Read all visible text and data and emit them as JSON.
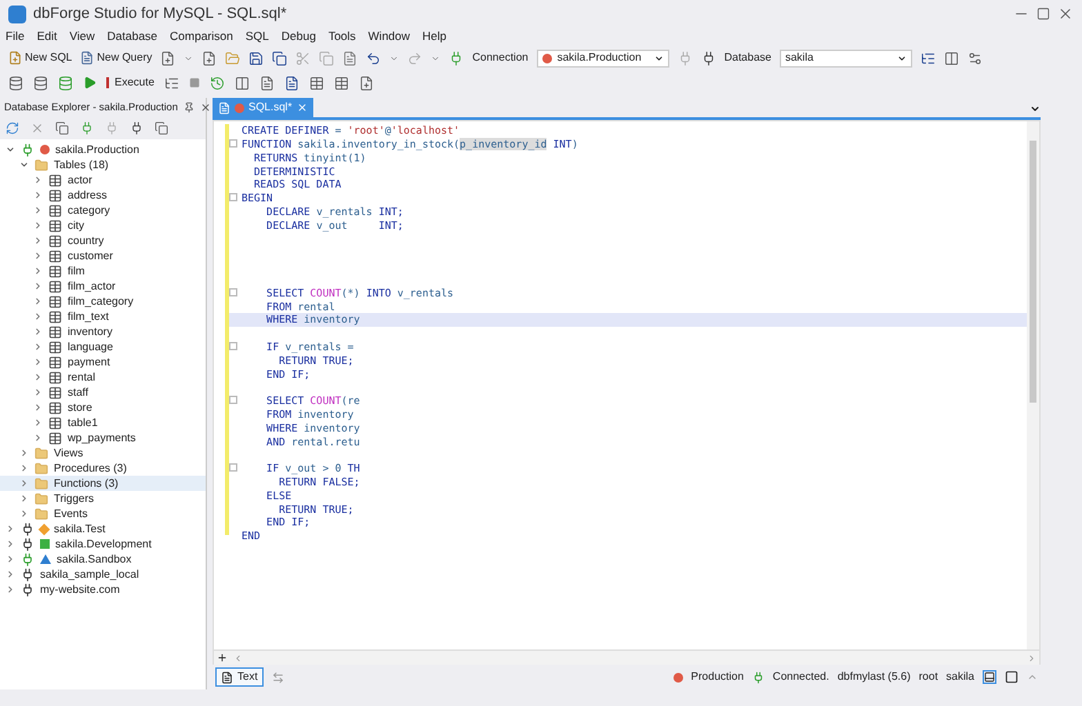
{
  "window": {
    "title": "dbForge Studio for MySQL - SQL.sql*"
  },
  "menu": [
    "File",
    "Edit",
    "View",
    "Database",
    "Comparison",
    "SQL",
    "Debug",
    "Tools",
    "Window",
    "Help"
  ],
  "toolbar": {
    "new_sql": "New SQL",
    "new_query": "New Query",
    "execute": "Execute",
    "connection_label": "Connection",
    "connection": {
      "value": "sakila.Production",
      "color": "#e05a47"
    },
    "database_label": "Database",
    "database": {
      "value": "sakila"
    }
  },
  "explorer": {
    "title": "Database Explorer - sakila.Production",
    "tree": [
      {
        "label": "sakila.Production",
        "kind": "connection",
        "marker": {
          "kind": "dot",
          "color": "#e05a47"
        },
        "connected": true,
        "expanded": true,
        "selected": false,
        "children": [
          {
            "label": "Tables (18)",
            "kind": "folder",
            "expanded": true,
            "selected": false,
            "children": [
              {
                "label": "actor",
                "kind": "table",
                "expanded": false,
                "selected": false
              },
              {
                "label": "address",
                "kind": "table",
                "expanded": false,
                "selected": false
              },
              {
                "label": "category",
                "kind": "table",
                "expanded": false,
                "selected": false
              },
              {
                "label": "city",
                "kind": "table",
                "expanded": false,
                "selected": false
              },
              {
                "label": "country",
                "kind": "table",
                "expanded": false,
                "selected": false
              },
              {
                "label": "customer",
                "kind": "table",
                "expanded": false,
                "selected": false
              },
              {
                "label": "film",
                "kind": "table",
                "expanded": false,
                "selected": false
              },
              {
                "label": "film_actor",
                "kind": "table",
                "expanded": false,
                "selected": false
              },
              {
                "label": "film_category",
                "kind": "table",
                "expanded": false,
                "selected": false
              },
              {
                "label": "film_text",
                "kind": "table",
                "expanded": false,
                "selected": false
              },
              {
                "label": "inventory",
                "kind": "table",
                "expanded": false,
                "selected": false
              },
              {
                "label": "language",
                "kind": "table",
                "expanded": false,
                "selected": false
              },
              {
                "label": "payment",
                "kind": "table",
                "expanded": false,
                "selected": false
              },
              {
                "label": "rental",
                "kind": "table",
                "expanded": false,
                "selected": false
              },
              {
                "label": "staff",
                "kind": "table",
                "expanded": false,
                "selected": false
              },
              {
                "label": "store",
                "kind": "table",
                "expanded": false,
                "selected": false
              },
              {
                "label": "table1",
                "kind": "table",
                "expanded": false,
                "selected": false
              },
              {
                "label": "wp_payments",
                "kind": "table",
                "expanded": false,
                "selected": false
              }
            ]
          },
          {
            "label": "Views",
            "kind": "folder",
            "expanded": false,
            "selected": false
          },
          {
            "label": "Procedures (3)",
            "kind": "folder",
            "expanded": false,
            "selected": false
          },
          {
            "label": "Functions (3)",
            "kind": "folder",
            "expanded": false,
            "selected": true
          },
          {
            "label": "Triggers",
            "kind": "folder",
            "expanded": false,
            "selected": false
          },
          {
            "label": "Events",
            "kind": "folder",
            "expanded": false,
            "selected": false
          }
        ]
      },
      {
        "label": "sakila.Test",
        "kind": "connection",
        "marker": {
          "kind": "diamond",
          "color": "#f0a030"
        },
        "connected": false,
        "expanded": false,
        "selected": false
      },
      {
        "label": "sakila.Development",
        "kind": "connection",
        "marker": {
          "kind": "square",
          "color": "#3cb043"
        },
        "connected": false,
        "expanded": false,
        "selected": false
      },
      {
        "label": "sakila.Sandbox",
        "kind": "connection",
        "marker": {
          "kind": "triangle",
          "color": "#2f7fd0"
        },
        "connected": true,
        "expanded": false,
        "selected": false
      },
      {
        "label": "sakila_sample_local",
        "kind": "connection",
        "connected": false,
        "expanded": false,
        "selected": false
      },
      {
        "label": "my-website.com",
        "kind": "connection",
        "connected": false,
        "expanded": false,
        "selected": false
      }
    ]
  },
  "editor": {
    "tab": {
      "label": "SQL.sql*",
      "selected": true
    },
    "lines": [
      {
        "kind": "code",
        "fold": false,
        "highlighted": false,
        "segments": [
          {
            "kind": "kw",
            "text": "CREATE DEFINER"
          },
          {
            "kind": "id",
            "text": " = "
          },
          {
            "kind": "str",
            "text": "'root'"
          },
          {
            "kind": "id",
            "text": "@"
          },
          {
            "kind": "str",
            "text": "'localhost'"
          }
        ]
      },
      {
        "kind": "code",
        "fold": true,
        "highlighted": false,
        "segments": [
          {
            "kind": "kw",
            "text": "FUNCTION "
          },
          {
            "kind": "id",
            "text": "sakila.inventory_in_stock("
          },
          {
            "kind": "mark",
            "text": "p_inventory_id"
          },
          {
            "kind": "kw",
            "text": " INT"
          },
          {
            "kind": "id",
            "text": ")"
          }
        ]
      },
      {
        "kind": "code",
        "fold": false,
        "highlighted": false,
        "segments": [
          {
            "kind": "kw",
            "text": "  RETURNS "
          },
          {
            "kind": "id",
            "text": "tinyint(1)"
          }
        ]
      },
      {
        "kind": "code",
        "fold": false,
        "highlighted": false,
        "segments": [
          {
            "kind": "kw",
            "text": "  DETERMINISTIC"
          }
        ]
      },
      {
        "kind": "code",
        "fold": false,
        "highlighted": false,
        "segments": [
          {
            "kind": "kw",
            "text": "  READS SQL DATA"
          }
        ]
      },
      {
        "kind": "code",
        "fold": true,
        "highlighted": false,
        "segments": [
          {
            "kind": "kw",
            "text": "BEGIN"
          }
        ]
      },
      {
        "kind": "code",
        "fold": false,
        "highlighted": false,
        "segments": [
          {
            "kind": "kw",
            "text": "    DECLARE "
          },
          {
            "kind": "id",
            "text": "v_rentals"
          },
          {
            "kind": "kw",
            "text": " INT;"
          }
        ]
      },
      {
        "kind": "code",
        "fold": false,
        "highlighted": false,
        "segments": [
          {
            "kind": "kw",
            "text": "    DECLARE "
          },
          {
            "kind": "id",
            "text": "v_out"
          },
          {
            "kind": "kw",
            "text": "     INT;"
          }
        ]
      },
      {
        "kind": "blank"
      },
      {
        "kind": "blank"
      },
      {
        "kind": "blank"
      },
      {
        "kind": "blank"
      },
      {
        "kind": "code",
        "fold": true,
        "highlighted": false,
        "segments": [
          {
            "kind": "kw",
            "text": "    SELECT "
          },
          {
            "kind": "fn",
            "text": "COUNT"
          },
          {
            "kind": "id",
            "text": "(*) "
          },
          {
            "kind": "kw",
            "text": "INTO "
          },
          {
            "kind": "id",
            "text": "v_rentals"
          }
        ]
      },
      {
        "kind": "code",
        "fold": false,
        "highlighted": false,
        "segments": [
          {
            "kind": "kw",
            "text": "    FROM "
          },
          {
            "kind": "id",
            "text": "rental"
          }
        ]
      },
      {
        "kind": "code",
        "fold": false,
        "highlighted": true,
        "segments": [
          {
            "kind": "kw",
            "text": "    WHERE "
          },
          {
            "kind": "id",
            "text": "inventory"
          }
        ]
      },
      {
        "kind": "blank"
      },
      {
        "kind": "code",
        "fold": true,
        "highlighted": false,
        "segments": [
          {
            "kind": "kw",
            "text": "    IF "
          },
          {
            "kind": "id",
            "text": "v_rentals ="
          }
        ]
      },
      {
        "kind": "code",
        "fold": false,
        "highlighted": false,
        "segments": [
          {
            "kind": "kw",
            "text": "      RETURN TRUE;"
          }
        ]
      },
      {
        "kind": "code",
        "fold": false,
        "highlighted": false,
        "segments": [
          {
            "kind": "kw",
            "text": "    END IF;"
          }
        ]
      },
      {
        "kind": "blank"
      },
      {
        "kind": "code",
        "fold": true,
        "highlighted": false,
        "segments": [
          {
            "kind": "kw",
            "text": "    SELECT "
          },
          {
            "kind": "fn",
            "text": "COUNT"
          },
          {
            "kind": "id",
            "text": "(re"
          }
        ]
      },
      {
        "kind": "code",
        "fold": false,
        "highlighted": false,
        "segments": [
          {
            "kind": "kw",
            "text": "    FROM "
          },
          {
            "kind": "id",
            "text": "inventory"
          }
        ]
      },
      {
        "kind": "code",
        "fold": false,
        "highlighted": false,
        "segments": [
          {
            "kind": "kw",
            "text": "    WHERE "
          },
          {
            "kind": "id",
            "text": "inventory"
          }
        ]
      },
      {
        "kind": "code",
        "fold": false,
        "highlighted": false,
        "segments": [
          {
            "kind": "kw",
            "text": "    AND "
          },
          {
            "kind": "id",
            "text": "rental.retu"
          }
        ]
      },
      {
        "kind": "blank"
      },
      {
        "kind": "code",
        "fold": true,
        "highlighted": false,
        "segments": [
          {
            "kind": "kw",
            "text": "    IF "
          },
          {
            "kind": "id",
            "text": "v_out > 0 "
          },
          {
            "kind": "kw",
            "text": "TH"
          }
        ]
      },
      {
        "kind": "code",
        "fold": false,
        "highlighted": false,
        "segments": [
          {
            "kind": "kw",
            "text": "      RETURN FALSE;"
          }
        ]
      },
      {
        "kind": "code",
        "fold": false,
        "highlighted": false,
        "segments": [
          {
            "kind": "kw",
            "text": "    ELSE"
          }
        ]
      },
      {
        "kind": "code",
        "fold": false,
        "highlighted": false,
        "segments": [
          {
            "kind": "kw",
            "text": "      RETURN TRUE;"
          }
        ]
      },
      {
        "kind": "code",
        "fold": false,
        "highlighted": false,
        "segments": [
          {
            "kind": "kw",
            "text": "    END IF;"
          }
        ]
      },
      {
        "kind": "code",
        "fold": false,
        "highlighted": false,
        "segments": [
          {
            "kind": "kw",
            "text": "END"
          }
        ]
      }
    ]
  },
  "status_bar": {
    "view_button": {
      "label": "Text",
      "selected": true
    },
    "environment": {
      "label": "Production",
      "color": "#e05a47"
    },
    "connection_state": "Connected.",
    "server": "dbfmylast (5.6)",
    "user": "root",
    "database": "sakila"
  }
}
